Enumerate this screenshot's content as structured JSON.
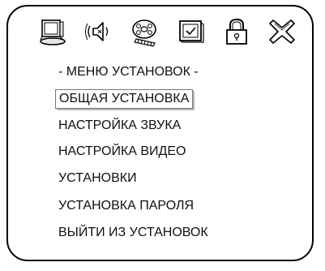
{
  "toolbar": {
    "icons": [
      {
        "name": "monitor-icon",
        "label": "general setup"
      },
      {
        "name": "speaker-icon",
        "label": "audio setup"
      },
      {
        "name": "film-reel-icon",
        "label": "video setup"
      },
      {
        "name": "checkbox-screen-icon",
        "label": "preferences"
      },
      {
        "name": "padlock-icon",
        "label": "password setup"
      },
      {
        "name": "close-x-icon",
        "label": "exit setup"
      }
    ]
  },
  "menu": {
    "title": "- МЕНЮ УСТАНОВОК -",
    "items": [
      "ОБЩАЯ УСТАНОВКА",
      "НАСТРОЙКА ЗВУКА",
      "НАСТРОЙКА ВИДЕО",
      "УСТАНОВКИ",
      "УСТАНОВКА ПАРОЛЯ",
      "ВЫЙТИ ИЗ УСТАНОВОК"
    ],
    "selected_index": 0
  }
}
